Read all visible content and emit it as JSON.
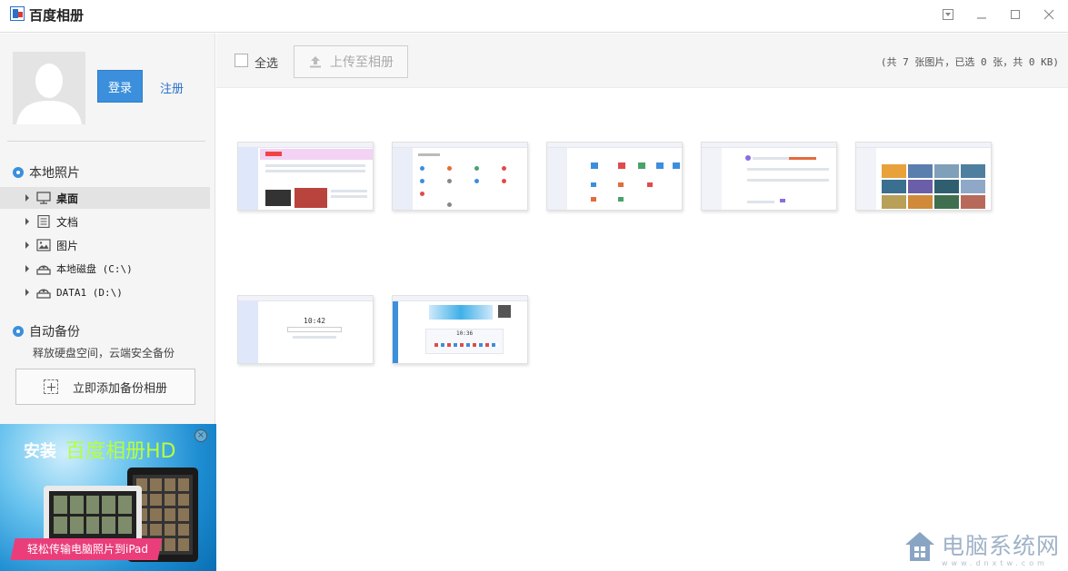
{
  "window": {
    "title": "百度相册",
    "controls": [
      "dropdown-icon",
      "minimize-icon",
      "maximize-icon",
      "close-icon"
    ]
  },
  "sidebar": {
    "login_label": "登录",
    "register_label": "注册",
    "local_photos": {
      "title": "本地照片",
      "items": [
        {
          "label": "桌面",
          "icon": "monitor-icon",
          "selected": true
        },
        {
          "label": "文档",
          "icon": "document-icon",
          "selected": false
        },
        {
          "label": "图片",
          "icon": "image-icon",
          "selected": false
        },
        {
          "label": "本地磁盘 (C:\\)",
          "icon": "disk-icon",
          "selected": false
        },
        {
          "label": "DATA1 (D:\\)",
          "icon": "disk-icon",
          "selected": false
        }
      ]
    },
    "auto_backup": {
      "title": "自动备份",
      "description": "释放硬盘空间，云端安全备份",
      "add_button": "立即添加备份相册"
    },
    "ad": {
      "title_part1": "安装",
      "title_part2": "百度相册HD",
      "banner": "轻松传输电脑照片到iPad"
    }
  },
  "toolbar": {
    "select_all_label": "全选",
    "upload_label": "上传至相册",
    "stats": "(共 7 张图片，已选 0 张，共 0 KB)"
  },
  "thumbnails": [
    {
      "name": "screenshot-1",
      "accent": "#d04fd1"
    },
    {
      "name": "screenshot-2",
      "accent": "#3b8fdc"
    },
    {
      "name": "screenshot-3",
      "accent": "#3b8fdc"
    },
    {
      "name": "screenshot-4",
      "accent": "#8a6de0"
    },
    {
      "name": "screenshot-5",
      "accent": "#e8a13b"
    },
    {
      "name": "screenshot-6",
      "accent": "#3b8fdc",
      "clock": "10:42"
    },
    {
      "name": "screenshot-7",
      "accent": "#3fb0e8",
      "clock": "10:36"
    }
  ],
  "watermark": {
    "text": "电脑系统网",
    "subtext": "www.dnxtw.com"
  },
  "colors": {
    "accent": "#3b8fdc",
    "sidebar_bg": "#f5f5f5",
    "ad_pink": "#ea3e7b"
  }
}
